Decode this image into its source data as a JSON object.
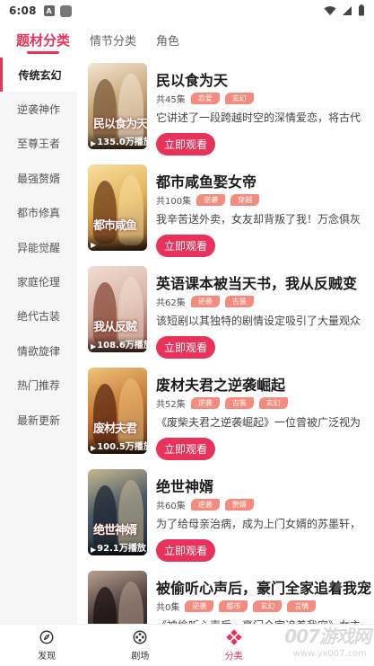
{
  "status_bar": {
    "time": "6:08",
    "notif_letter": "A"
  },
  "top_tabs": [
    {
      "label": "题材分类",
      "active": true
    },
    {
      "label": "情节分类",
      "active": false
    },
    {
      "label": "角色",
      "active": false
    }
  ],
  "sidebar": {
    "items": [
      {
        "label": "传统玄幻",
        "active": true
      },
      {
        "label": "逆袭神作",
        "active": false
      },
      {
        "label": "至尊王者",
        "active": false
      },
      {
        "label": "最强赘婿",
        "active": false
      },
      {
        "label": "都市修真",
        "active": false
      },
      {
        "label": "异能觉醒",
        "active": false
      },
      {
        "label": "家庭伦理",
        "active": false
      },
      {
        "label": "绝代古装",
        "active": false
      },
      {
        "label": "情欲旋律",
        "active": false
      },
      {
        "label": "热门推荐",
        "active": false
      },
      {
        "label": "最新更新",
        "active": false
      }
    ]
  },
  "dramas": [
    {
      "title": "民以食为天",
      "episodes": "共45集",
      "tags": [
        "恋爱",
        "玄幻"
      ],
      "description": "它讲述了一段跨越时空的深情爱恋，将古代",
      "plays": "135.0万播放",
      "poster_text": "民以食为天",
      "button": "立即观看",
      "palette": [
        "#c9a87a",
        "#7b5a3a",
        "#f2e6d2"
      ]
    },
    {
      "title": "都市咸鱼娶女帝",
      "episodes": "共100集",
      "tags": [
        "逆袭",
        "穿越"
      ],
      "description": "我辛苦送外卖，女友却背叛了我！万念俱灰",
      "plays": "",
      "poster_text": "都市咸鱼",
      "button": "立即观看",
      "palette": [
        "#e3b45b",
        "#6b3b1a",
        "#f7dfa0"
      ]
    },
    {
      "title": "英语课本被当天书，我从反贼变",
      "episodes": "共62集",
      "tags": [
        "逆袭",
        "古装"
      ],
      "description": "该短剧以其独特的剧情设定吸引了大量观众",
      "plays": "108.6万播放",
      "poster_text": "我从反贼",
      "button": "立即观看",
      "palette": [
        "#d9b7a8",
        "#8a4a3a",
        "#f1dcd2"
      ]
    },
    {
      "title": "废材夫君之逆袭崛起",
      "episodes": "共52集",
      "tags": [
        "逆袭",
        "古装",
        "玄幻"
      ],
      "description": "《废柴夫君之逆袭崛起》一位曾被广泛视为",
      "plays": "100.5万播放",
      "poster_text": "废材夫君",
      "button": "立即观看",
      "palette": [
        "#c87a3a",
        "#5a2a12",
        "#efc37a"
      ]
    },
    {
      "title": "绝世神婿",
      "episodes": "共60集",
      "tags": [
        "逆袭",
        "赘婿"
      ],
      "description": "为了给母亲治病，成为上门女婿的苏墨轩，",
      "plays": "92.1万播放",
      "poster_text": "绝世神婿",
      "button": "立即观看",
      "palette": [
        "#4a5a68",
        "#1d2530",
        "#c8b890"
      ]
    },
    {
      "title": "被偷听心声后，豪门全家追着我宠",
      "episodes": "共0集",
      "tags": [
        "逆袭",
        "都市",
        "玄幻",
        "言情"
      ],
      "description": "《被偷听心声后，豪门全家追着我宠》女主",
      "plays": "",
      "poster_text": "",
      "button": "立即观看",
      "palette": [
        "#4a3a3a",
        "#1a1212",
        "#b8a090"
      ]
    }
  ],
  "bottom_nav": [
    {
      "label": "发现",
      "icon": "compass-icon",
      "active": false
    },
    {
      "label": "剧场",
      "icon": "film-reel-icon",
      "active": false
    },
    {
      "label": "分类",
      "icon": "category-icon",
      "active": true
    },
    {
      "label": "",
      "icon": "",
      "active": false
    }
  ],
  "watermark": {
    "text": "007游戏网",
    "url": "www.yx007.com"
  }
}
